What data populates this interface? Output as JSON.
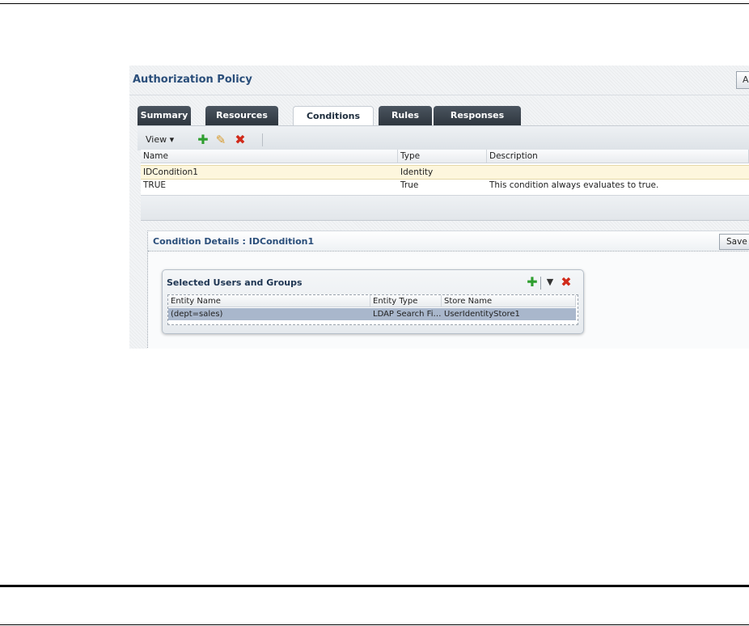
{
  "page": {
    "title": "Authorization Policy",
    "apply_label": "A"
  },
  "tabs": [
    {
      "label": "Summary",
      "active": false
    },
    {
      "label": "Resources",
      "active": false
    },
    {
      "label": "Conditions",
      "active": true
    },
    {
      "label": "Rules",
      "active": false
    },
    {
      "label": "Responses",
      "active": false
    }
  ],
  "toolbar": {
    "view_label": "View",
    "view_caret": "▾",
    "icons": [
      "add-icon",
      "edit-icon",
      "delete-icon"
    ]
  },
  "conditions_table": {
    "columns": [
      "Name",
      "Type",
      "Description"
    ],
    "rows": [
      {
        "name": "IDCondition1",
        "type": "Identity",
        "description": ""
      },
      {
        "name": "TRUE",
        "type": "True",
        "description": "This condition always evaluates to true."
      }
    ]
  },
  "details": {
    "title": "Condition Details : IDCondition1",
    "save_label": "Save"
  },
  "users_groups": {
    "title": "Selected Users and Groups",
    "columns": [
      "Entity Name",
      "Entity Type",
      "Store Name"
    ],
    "rows": [
      {
        "entity_name": "(dept=sales)",
        "entity_type": "LDAP Search Fi…",
        "store_name": "UserIdentityStore1"
      }
    ]
  },
  "colors": {
    "title_blue": "#2a4e7a",
    "add_green": "#2f9e2f",
    "delete_red": "#d12a1a",
    "edit_orange": "#d89a2a",
    "selected_row": "#a9b7cc"
  }
}
